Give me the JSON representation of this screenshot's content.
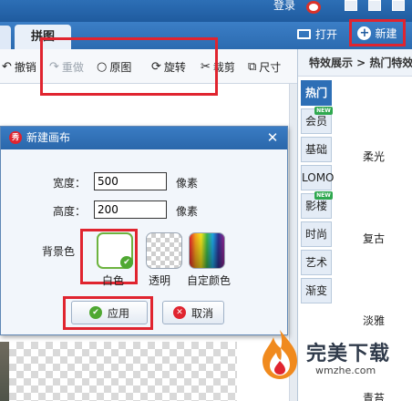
{
  "topbar": {
    "login": "登录"
  },
  "tabs": {
    "pin": "拼图"
  },
  "header_actions": {
    "open": "打开",
    "new": "新建"
  },
  "toolbar": {
    "undo": "撤销",
    "redo": "重做",
    "original": "原图",
    "rotate": "旋转",
    "crop": "裁剪",
    "size": "尺寸"
  },
  "right_panel": {
    "heading": "特效展示 > 热门特效",
    "tabs": [
      {
        "label": "热门",
        "new": false
      },
      {
        "label": "会员",
        "new": true
      },
      {
        "label": "基础",
        "new": false
      },
      {
        "label": "LOMO",
        "new": false
      },
      {
        "label": "影楼",
        "new": true
      },
      {
        "label": "时尚",
        "new": false
      },
      {
        "label": "艺术",
        "new": false
      },
      {
        "label": "渐变",
        "new": false
      }
    ],
    "new_tag": "NEW",
    "effects": [
      "柔光",
      "复古",
      "淡雅",
      "青苔"
    ]
  },
  "dialog": {
    "title": "新建画布",
    "width_label": "宽度：",
    "width_value": "500",
    "height_label": "高度：",
    "height_value": "200",
    "unit": "像素",
    "bg_label": "背景色",
    "bg_options": [
      "白色",
      "透明",
      "自定颜色"
    ],
    "selected_bg": "白色",
    "apply": "应用",
    "cancel": "取消"
  },
  "watermark": {
    "title": "完美下载",
    "url": "wmzhe.com"
  },
  "colors": {
    "accent": "#2d6fb6",
    "highlight": "#e0242f",
    "ok": "#4fa832"
  }
}
